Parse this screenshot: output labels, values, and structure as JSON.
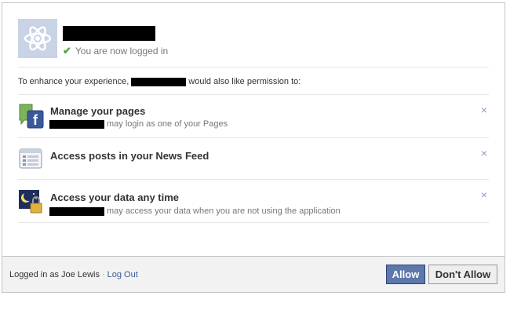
{
  "header": {
    "login_status": "You are now logged in"
  },
  "intro": {
    "before": "To enhance your experience,",
    "after": "would also like permission to:"
  },
  "permissions": [
    {
      "title": "Manage your pages",
      "description": "may login as one of your Pages",
      "icon": "pages-icon"
    },
    {
      "title": "Access posts in your News Feed",
      "description": "",
      "icon": "news-feed-icon"
    },
    {
      "title": "Access your data any time",
      "description": "may access your data when you are not using the application",
      "icon": "offline-access-icon"
    }
  ],
  "close_glyph": "×",
  "footer": {
    "logged_in_as": "Logged in as Joe Lewis",
    "separator": "·",
    "logout_label": "Log Out",
    "allow_label": "Allow",
    "deny_label": "Don't Allow"
  },
  "colors": {
    "link": "#3b5998",
    "allow_button": "#5f78ab",
    "check": "#5aa33f"
  }
}
